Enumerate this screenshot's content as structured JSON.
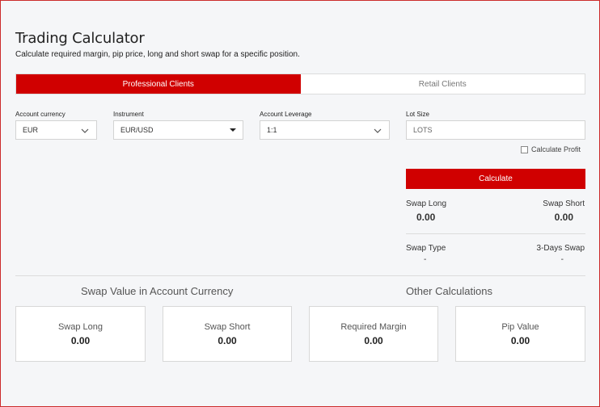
{
  "header": {
    "title": "Trading Calculator",
    "subtitle": "Calculate required margin, pip price, long and short swap for a specific position."
  },
  "tabs": [
    {
      "label": "Professional Clients",
      "active": true
    },
    {
      "label": "Retail Clients",
      "active": false
    }
  ],
  "form": {
    "account_currency": {
      "label": "Account currency",
      "value": "EUR"
    },
    "instrument": {
      "label": "Instrument",
      "value": "EUR/USD"
    },
    "account_leverage": {
      "label": "Account Leverage",
      "value": "1:1"
    },
    "lot_size": {
      "label": "Lot Size",
      "placeholder": "LOTS"
    },
    "calculate_profit_label": "Calculate Profit",
    "calculate_button": "Calculate"
  },
  "results": {
    "swap_long_label": "Swap Long",
    "swap_long_value": "0.00",
    "swap_short_label": "Swap Short",
    "swap_short_value": "0.00",
    "swap_type_label": "Swap Type",
    "swap_type_value": "-",
    "three_days_swap_label": "3-Days Swap",
    "three_days_swap_value": "-"
  },
  "sections": {
    "swap_value_title": "Swap Value in Account Currency",
    "other_title": "Other Calculations"
  },
  "cards": [
    {
      "label": "Swap Long",
      "value": "0.00"
    },
    {
      "label": "Swap Short",
      "value": "0.00"
    },
    {
      "label": "Required Margin",
      "value": "0.00"
    },
    {
      "label": "Pip Value",
      "value": "0.00"
    }
  ],
  "colors": {
    "accent": "#d00000",
    "border": "#cc2b2b"
  }
}
